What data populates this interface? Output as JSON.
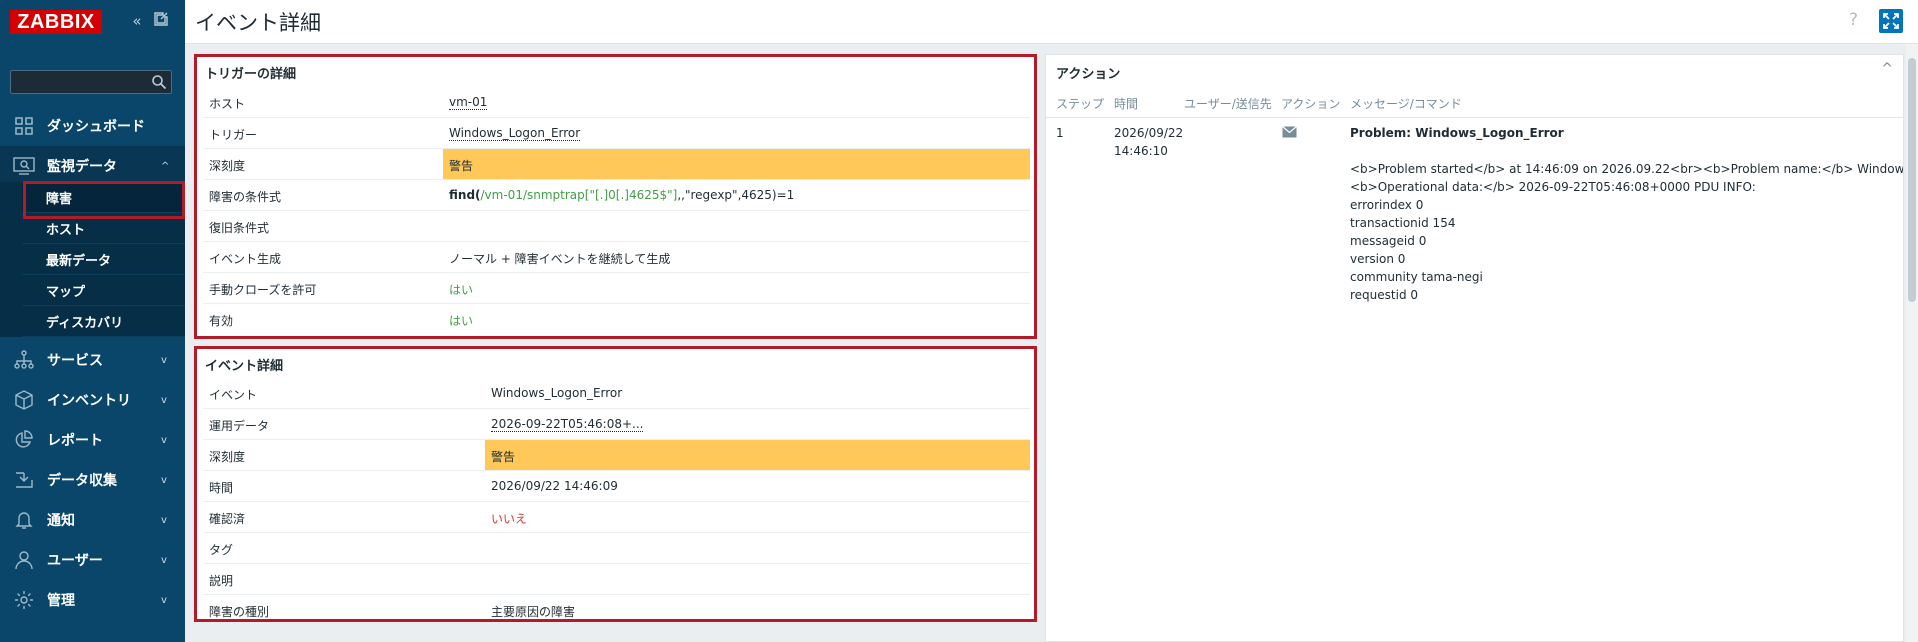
{
  "app": {
    "logo": "ZABBIX"
  },
  "page": {
    "title": "イベント詳細",
    "help": "?"
  },
  "sidebar": {
    "search_placeholder": "",
    "nav": [
      {
        "id": "dashboard",
        "label": "ダッシュボード",
        "icon": "dashboard-icon"
      },
      {
        "id": "monitoring",
        "label": "監視データ",
        "icon": "monitoring-icon",
        "expanded": true
      },
      {
        "id": "services",
        "label": "サービス",
        "icon": "services-icon"
      },
      {
        "id": "inventory",
        "label": "インベントリ",
        "icon": "inventory-icon"
      },
      {
        "id": "reports",
        "label": "レポート",
        "icon": "reports-icon"
      },
      {
        "id": "datacollection",
        "label": "データ収集",
        "icon": "data-collection-icon"
      },
      {
        "id": "alerts",
        "label": "通知",
        "icon": "bell-icon"
      },
      {
        "id": "users",
        "label": "ユーザー",
        "icon": "user-icon"
      },
      {
        "id": "admin",
        "label": "管理",
        "icon": "gear-icon"
      }
    ],
    "monitoring_sub": [
      "障害",
      "ホスト",
      "最新データ",
      "マップ",
      "ディスカバリ"
    ]
  },
  "trigger": {
    "title": "トリガーの詳細",
    "rows": {
      "host": {
        "k": "ホスト",
        "v": "vm-01"
      },
      "trigger": {
        "k": "トリガー",
        "v": "Windows_Logon_Error"
      },
      "severity": {
        "k": "深刻度",
        "v": "警告"
      },
      "problem_expr": {
        "k": "障害の条件式",
        "fn": "find(",
        "item": "/vm-01/snmptrap[\"[.]0[.]4625$\"]",
        "rest": ",,\"regexp\",4625)=1"
      },
      "recovery_expr": {
        "k": "復旧条件式",
        "v": ""
      },
      "event_gen": {
        "k": "イベント生成",
        "v": "ノーマル + 障害イベントを継続して生成"
      },
      "manual_close": {
        "k": "手動クローズを許可",
        "v": "はい"
      },
      "enabled": {
        "k": "有効",
        "v": "はい"
      }
    }
  },
  "event": {
    "title": "イベント詳細",
    "rows": {
      "event": {
        "k": "イベント",
        "v": "Windows_Logon_Error"
      },
      "opdata": {
        "k": "運用データ",
        "v": "2026-09-22T05:46:08+..."
      },
      "severity": {
        "k": "深刻度",
        "v": "警告"
      },
      "time": {
        "k": "時間",
        "v": "2026/09/22 14:46:09"
      },
      "ack": {
        "k": "確認済",
        "v": "いいえ"
      },
      "tags": {
        "k": "タグ",
        "v": ""
      },
      "desc": {
        "k": "説明",
        "v": ""
      },
      "cause": {
        "k": "障害の種別",
        "v": "主要原因の障害"
      }
    }
  },
  "actions": {
    "title": "アクション",
    "headers": {
      "step": "ステップ",
      "time": "時間",
      "user": "ユーザー/送信先",
      "action": "アクション",
      "message": "メッセージ/コマンド"
    },
    "row": {
      "step": "1",
      "date": "2026/09/22",
      "clock": "14:46:10",
      "action_icon": "envelope-icon",
      "subject": "Problem: Windows_Logon_Error",
      "body": [
        "<b>Problem started</b> at 14:46:09 on 2026.09.22<br><b>Problem name:</b> Windows_Logon_Error<",
        "<b>Operational data:</b> 2026-09-22T05:46:08+0000 PDU INFO:",
        "errorindex 0",
        "transactionid 154",
        "messageid 0",
        "version 0",
        "community tama-negi",
        "requestid 0"
      ]
    }
  },
  "colors": {
    "sidebar": "#0a466a",
    "severity_warning": "#ffc859",
    "highlight": "#b31b29",
    "accent": "#0275b8"
  }
}
